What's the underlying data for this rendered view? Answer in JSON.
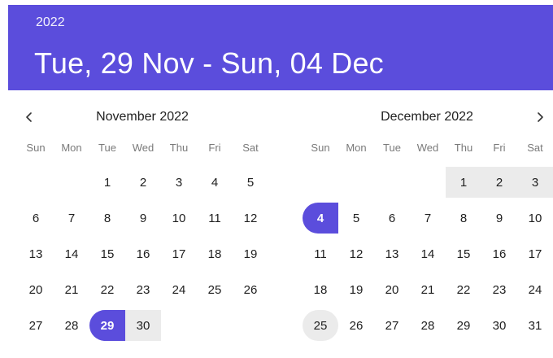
{
  "header": {
    "year": "2022",
    "range_text": "Tue, 29 Nov - Sun, 04 Dec"
  },
  "weekdays": [
    "Sun",
    "Mon",
    "Tue",
    "Wed",
    "Thu",
    "Fri",
    "Sat"
  ],
  "icons": {
    "prev": "chevron-left-icon",
    "next": "chevron-right-icon"
  },
  "colors": {
    "accent": "#5b4ddc",
    "range_fill": "#ebebeb"
  },
  "months": [
    {
      "title": "November 2022",
      "leading_blanks": 2,
      "days": [
        {
          "label": "1"
        },
        {
          "label": "2"
        },
        {
          "label": "3"
        },
        {
          "label": "4"
        },
        {
          "label": "5"
        },
        {
          "label": "6"
        },
        {
          "label": "7"
        },
        {
          "label": "8"
        },
        {
          "label": "9"
        },
        {
          "label": "10"
        },
        {
          "label": "11"
        },
        {
          "label": "12"
        },
        {
          "label": "13"
        },
        {
          "label": "14"
        },
        {
          "label": "15"
        },
        {
          "label": "16"
        },
        {
          "label": "17"
        },
        {
          "label": "18"
        },
        {
          "label": "19"
        },
        {
          "label": "20"
        },
        {
          "label": "21"
        },
        {
          "label": "22"
        },
        {
          "label": "23"
        },
        {
          "label": "24"
        },
        {
          "label": "25"
        },
        {
          "label": "26"
        },
        {
          "label": "27"
        },
        {
          "label": "28"
        },
        {
          "label": "29",
          "state": "selected-range-start"
        },
        {
          "label": "30",
          "state": "in-range"
        }
      ]
    },
    {
      "title": "December 2022",
      "leading_blanks": 4,
      "days": [
        {
          "label": "1",
          "state": "in-range"
        },
        {
          "label": "2",
          "state": "in-range"
        },
        {
          "label": "3",
          "state": "in-range"
        },
        {
          "label": "4",
          "state": "selected-range-end"
        },
        {
          "label": "5"
        },
        {
          "label": "6"
        },
        {
          "label": "7"
        },
        {
          "label": "8"
        },
        {
          "label": "9"
        },
        {
          "label": "10"
        },
        {
          "label": "11"
        },
        {
          "label": "12"
        },
        {
          "label": "13"
        },
        {
          "label": "14"
        },
        {
          "label": "15"
        },
        {
          "label": "16"
        },
        {
          "label": "17"
        },
        {
          "label": "18"
        },
        {
          "label": "19"
        },
        {
          "label": "20"
        },
        {
          "label": "21"
        },
        {
          "label": "22"
        },
        {
          "label": "23"
        },
        {
          "label": "24"
        },
        {
          "label": "25",
          "state": "today"
        },
        {
          "label": "26"
        },
        {
          "label": "27"
        },
        {
          "label": "28"
        },
        {
          "label": "29"
        },
        {
          "label": "30"
        },
        {
          "label": "31"
        }
      ]
    }
  ]
}
